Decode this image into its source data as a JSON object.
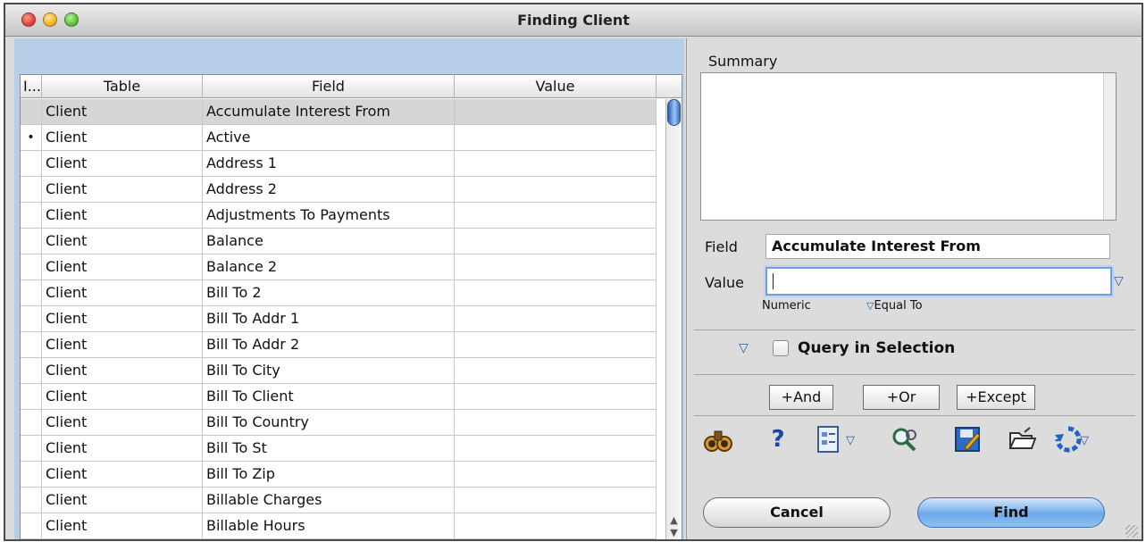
{
  "window": {
    "title": "Finding Client"
  },
  "grid": {
    "columns": [
      "I...",
      "Table",
      "Field",
      "Value"
    ],
    "rows": [
      {
        "indicator": "",
        "table": "Client",
        "field": "Accumulate Interest From",
        "value": "",
        "selected": true
      },
      {
        "indicator": "•",
        "table": "Client",
        "field": "Active",
        "value": ""
      },
      {
        "indicator": "",
        "table": "Client",
        "field": "Address 1",
        "value": ""
      },
      {
        "indicator": "",
        "table": "Client",
        "field": "Address 2",
        "value": ""
      },
      {
        "indicator": "",
        "table": "Client",
        "field": "Adjustments To Payments",
        "value": ""
      },
      {
        "indicator": "",
        "table": "Client",
        "field": "Balance",
        "value": ""
      },
      {
        "indicator": "",
        "table": "Client",
        "field": "Balance 2",
        "value": ""
      },
      {
        "indicator": "",
        "table": "Client",
        "field": "Bill To 2",
        "value": ""
      },
      {
        "indicator": "",
        "table": "Client",
        "field": "Bill To Addr 1",
        "value": ""
      },
      {
        "indicator": "",
        "table": "Client",
        "field": "Bill To Addr 2",
        "value": ""
      },
      {
        "indicator": "",
        "table": "Client",
        "field": "Bill To City",
        "value": ""
      },
      {
        "indicator": "",
        "table": "Client",
        "field": "Bill To Client",
        "value": ""
      },
      {
        "indicator": "",
        "table": "Client",
        "field": "Bill To Country",
        "value": ""
      },
      {
        "indicator": "",
        "table": "Client",
        "field": "Bill To St",
        "value": ""
      },
      {
        "indicator": "",
        "table": "Client",
        "field": "Bill To Zip",
        "value": ""
      },
      {
        "indicator": "",
        "table": "Client",
        "field": "Billable Charges",
        "value": ""
      },
      {
        "indicator": "",
        "table": "Client",
        "field": "Billable Hours",
        "value": ""
      }
    ]
  },
  "summary": {
    "label": "Summary"
  },
  "criteria": {
    "field_label": "Field",
    "field_value": "Accumulate Interest From",
    "value_label": "Value",
    "value_text": "",
    "type_label": "Numeric",
    "operator_label": "Equal To",
    "query_in_selection": "Query in Selection"
  },
  "operators": {
    "and": "+And",
    "or": "+Or",
    "except": "+Except"
  },
  "toolbar": {
    "help_glyph": "?"
  },
  "buttons": {
    "cancel": "Cancel",
    "find": "Find"
  }
}
